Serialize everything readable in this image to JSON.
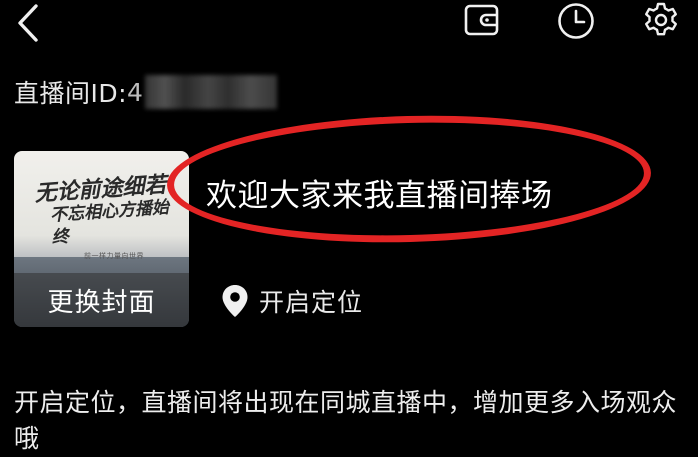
{
  "header": {
    "back_icon": "chevron-left-icon",
    "wallet_icon": "wallet-icon",
    "history_icon": "clock-icon",
    "settings_icon": "gear-icon"
  },
  "room": {
    "id_label": "直播间ID:",
    "id_visible_char": "4"
  },
  "cover": {
    "calligraphy_line1": "无论前途细若",
    "calligraphy_line2": "不忘相心方播始终",
    "small_text": "前一样力量向世界",
    "change_button": "更换封面"
  },
  "title": {
    "text": "欢迎大家来我直播间捧场",
    "highlight_color": "#e32424"
  },
  "location": {
    "icon": "location-pin-icon",
    "label": "开启定位"
  },
  "description": {
    "text": "开启定位，直播间将出现在同城直播中，增加更多入场观众哦"
  }
}
